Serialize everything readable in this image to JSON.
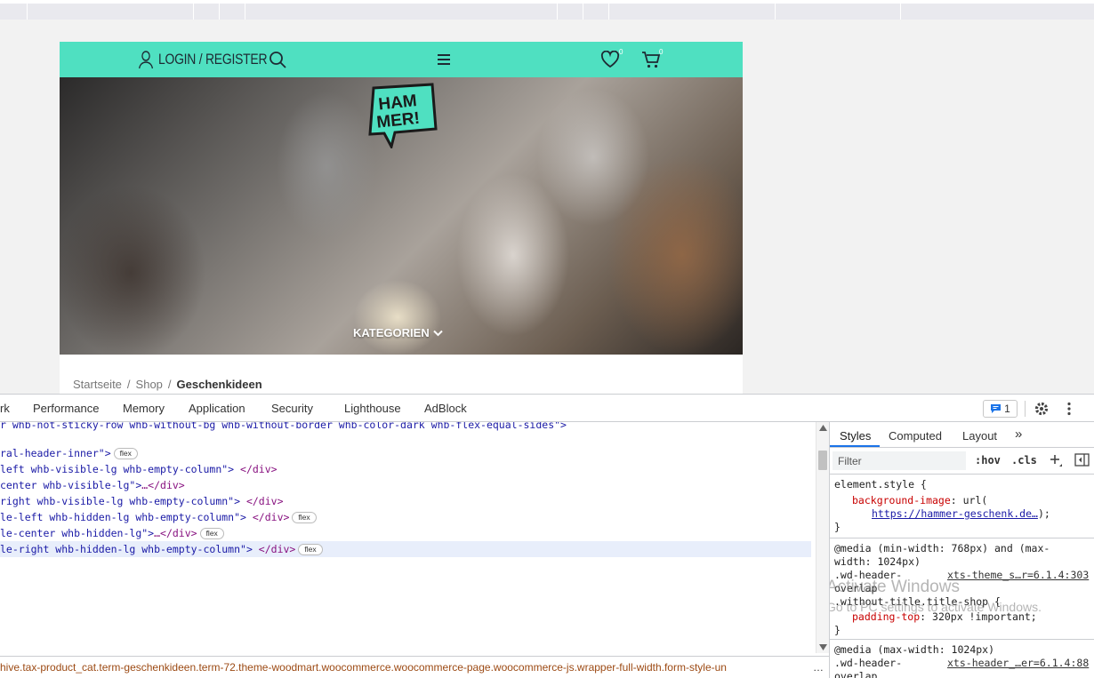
{
  "site": {
    "login_label": "LOGIN / REGISTER",
    "wishlist_count": "0",
    "cart_count": "0",
    "logo_text_1": "HAM",
    "logo_text_2": "MER!",
    "hero_button": "KATEGORIEN",
    "breadcrumbs": [
      "Startseite",
      "Shop",
      "Geschenkideen"
    ],
    "accent_color": "#4fe0c1"
  },
  "devtools": {
    "tabs": [
      "rk",
      "Performance",
      "Memory",
      "Application",
      "Security",
      "Lighthouse",
      "AdBlock"
    ],
    "issues_count": "1",
    "code_lines": [
      {
        "pre": "r whb-not-sticky-row whb-without-bg whb-without-border whb-color-dark whb-flex-equal-sides\">",
        "post": "",
        "pill": ""
      },
      {
        "pre": "",
        "post": "",
        "pill": ""
      },
      {
        "pre": "ral-header-inner\">",
        "post": "",
        "pill": "flex"
      },
      {
        "pre": "left whb-visible-lg whb-empty-column\">",
        "post": " </div>",
        "pill": ""
      },
      {
        "pre": "center whb-visible-lg\">",
        "post": "…</div>",
        "pill": ""
      },
      {
        "pre": "right whb-visible-lg whb-empty-column\">",
        "post": " </div>",
        "pill": ""
      },
      {
        "pre": "le-left whb-hidden-lg whb-empty-column\">",
        "post": " </div>",
        "pill": "flex"
      },
      {
        "pre": "le-center whb-hidden-lg\">",
        "post": "…</div>",
        "pill": "flex"
      },
      {
        "pre": "le-right whb-hidden-lg whb-empty-column\">",
        "post": " </div>",
        "pill": "flex"
      }
    ],
    "path_text": "hive.tax-product_cat.term-geschenkideen.term-72.theme-woodmart.woocommerce.woocommerce-page.woocommerce-js.wrapper-full-width.form-style-un",
    "path_more": "…",
    "styles_tabs": [
      "Styles",
      "Computed",
      "Layout",
      "»"
    ],
    "filter_placeholder": "Filter",
    "filter_hov": ":hov",
    "filter_cls": ".cls",
    "rule1": {
      "selector": "element.style {",
      "prop": "background-image",
      "value_pre": ": url(",
      "link": "https://hammer-geschenk.de…",
      "value_post": ");",
      "close": "}"
    },
    "rule2": {
      "media": "@media (min-width: 768px) and (max-",
      "media2": "width: 1024px)",
      "sel1": ".wd-header-",
      "src": "xts-theme_s…r=6.1.4:303",
      "sel2": "overlap",
      "sel3": ".without-title.title-shop {",
      "prop": "padding-top",
      "value": ": 320px !important;",
      "close": "}"
    },
    "rule3": {
      "media": "@media (max-width: 1024px)",
      "sel1": ".wd-header-",
      "src": "xts-header_…er=6.1.4:88",
      "sel2": "overlap"
    },
    "watermark_title": "Activate Windows",
    "watermark_sub": "Go to PC settings to activate Windows."
  }
}
